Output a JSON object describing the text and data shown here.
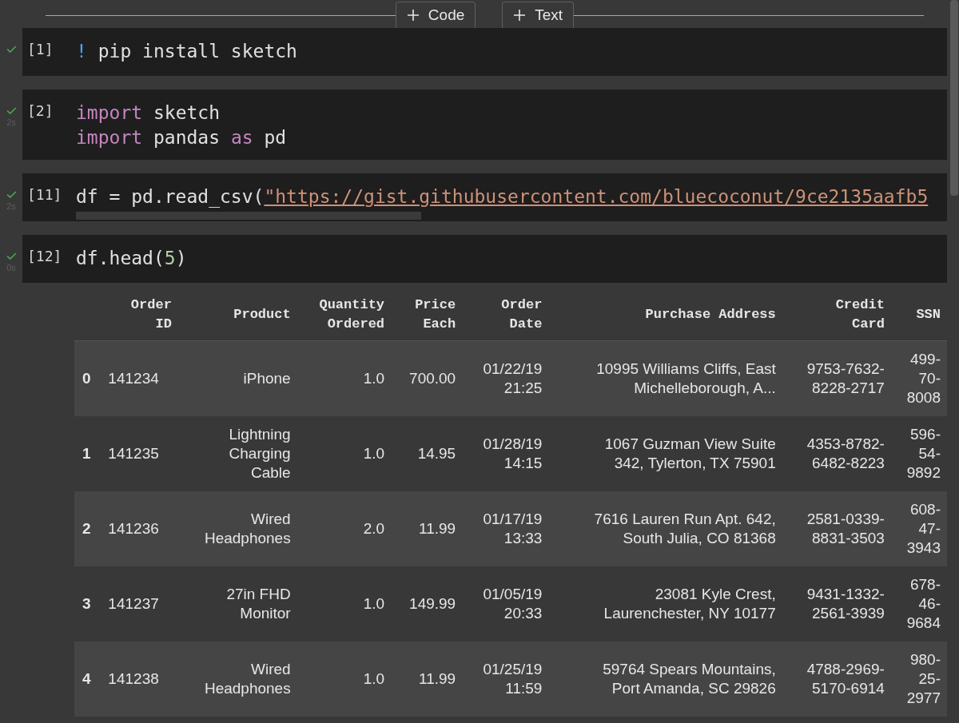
{
  "toolbar": {
    "buttons": [
      {
        "label": "Code"
      },
      {
        "label": "Text"
      }
    ]
  },
  "cells": [
    {
      "count": "[1]",
      "ran": true,
      "lines": [
        [
          {
            "text": "!",
            "kind": "shell"
          },
          {
            "text": " pip install sketch",
            "kind": "plain"
          }
        ]
      ]
    },
    {
      "count": "[2]",
      "ran": true,
      "time": "2s",
      "lines": [
        [
          {
            "text": "import",
            "kind": "keyword"
          },
          {
            "text": " sketch",
            "kind": "plain"
          }
        ],
        [
          {
            "text": "import",
            "kind": "keyword"
          },
          {
            "text": " pandas ",
            "kind": "plain"
          },
          {
            "text": "as",
            "kind": "keyword"
          },
          {
            "text": " pd",
            "kind": "plain"
          }
        ]
      ]
    },
    {
      "count": "[11]",
      "ran": true,
      "time": "2s",
      "hscroll": true,
      "lines": [
        [
          {
            "text": "df = pd.read_csv(",
            "kind": "plain"
          },
          {
            "text": "\"https://gist.githubusercontent.com/bluecoconut/9ce2135aafb5",
            "kind": "link"
          }
        ]
      ]
    },
    {
      "count": "[12]",
      "ran": true,
      "time": "0s",
      "lines": [
        [
          {
            "text": "df.head(",
            "kind": "plain"
          },
          {
            "text": "5",
            "kind": "number"
          },
          {
            "text": ")",
            "kind": "plain"
          }
        ]
      ]
    }
  ],
  "output_table": {
    "columns": [
      "Order\nID",
      "Product",
      "Quantity\nOrdered",
      "Price\nEach",
      "Order\nDate",
      "Purchase Address",
      "Credit\nCard",
      "SSN"
    ],
    "rows": [
      {
        "index": "0",
        "cells": [
          "141234",
          "iPhone",
          "1.0",
          "700.00",
          "01/22/19\n21:25",
          "10995 Williams Cliffs, East\nMichelleborough, A...",
          "9753-7632-\n8228-2717",
          "499-\n70-\n8008"
        ]
      },
      {
        "index": "1",
        "cells": [
          "141235",
          "Lightning\nCharging\nCable",
          "1.0",
          "14.95",
          "01/28/19\n14:15",
          "1067 Guzman View Suite\n342, Tylerton, TX 75901",
          "4353-8782-\n6482-8223",
          "596-\n54-\n9892"
        ]
      },
      {
        "index": "2",
        "cells": [
          "141236",
          "Wired\nHeadphones",
          "2.0",
          "11.99",
          "01/17/19\n13:33",
          "7616 Lauren Run Apt. 642,\nSouth Julia, CO 81368",
          "2581-0339-\n8831-3503",
          "608-\n47-\n3943"
        ]
      },
      {
        "index": "3",
        "cells": [
          "141237",
          "27in FHD\nMonitor",
          "1.0",
          "149.99",
          "01/05/19\n20:33",
          "23081 Kyle Crest,\nLaurenchester, NY 10177",
          "9431-1332-\n2561-3939",
          "678-\n46-\n9684"
        ]
      },
      {
        "index": "4",
        "cells": [
          "141238",
          "Wired\nHeadphones",
          "1.0",
          "11.99",
          "01/25/19\n11:59",
          "59764 Spears Mountains,\nPort Amanda, SC 29826",
          "4788-2969-\n5170-6914",
          "980-\n25-\n2977"
        ]
      }
    ]
  }
}
